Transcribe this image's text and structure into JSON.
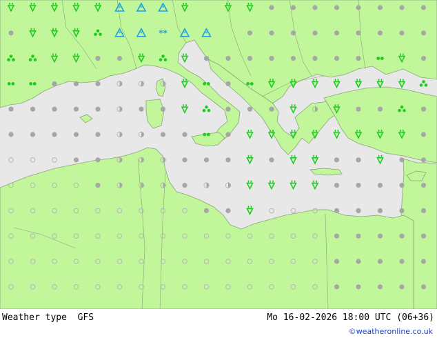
{
  "footer": {
    "model_label": "Weather type  GFS",
    "datetime": "Mo 16-02-2026 18:00 UTC (06+36)",
    "credit": "©weatheronline.co.uk"
  },
  "colors": {
    "land": "#c1f79a",
    "sea": "#e8e8e8",
    "coast": "#8aa27a",
    "rain": "#1dcc1d",
    "snow": "#1aa0e6",
    "cloud": "#a6a6a6",
    "clear": "#b5b5b5"
  },
  "legend_symbols": {
    "rain": "rain-drops-icon",
    "showers": "shower-cloud-icon",
    "snow": "snow-icon",
    "snow_showers": "snow-shower-icon",
    "overcast": "cloud-dot-icon",
    "partly": "half-disc-icon",
    "clear": "clear-circle-icon"
  },
  "grid": {
    "rows": [
      "RRRRRAAHR.RRCCCCCCCC",
      "CRRRTAAWAA.CCCCCCCCC",
      "TTRRCCRTRCCCCCCCCDRC",
      "DDCCCPPPRDCDRRRRRRRT",
      "CCCCCPCCRTCCCRPRCCTC",
      "CCCCCPPCCDCRRRRRRRRC",
      "OOOCCPPPCCCRCRRCCRCC",
      "OOOOCPPPCPPRRRRCCCCC",
      "OOOOOOOOOCCROOOCCCCC",
      "OOOOOOOOOOOOOOOCCCCC",
      "OOOOOOOOOOOOOOOCCCCC",
      "OOOOOOOOOOOOOOOCCCCC",
      "OOOOOOOOOOOOOOOCCCCC"
    ]
  }
}
